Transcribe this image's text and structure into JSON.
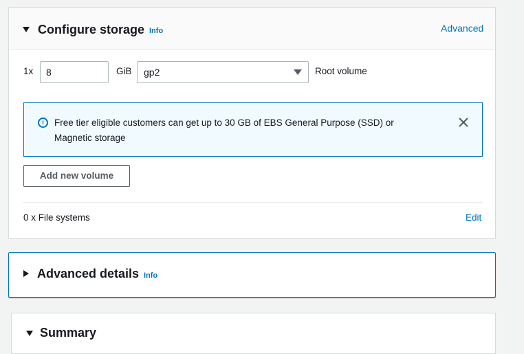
{
  "storage": {
    "title": "Configure storage",
    "info": "Info",
    "advanced_link": "Advanced",
    "volume": {
      "count": "1x",
      "size": "8",
      "unit": "GiB",
      "type": "gp2",
      "label": "Root volume"
    },
    "alert": {
      "text": "Free tier eligible customers can get up to 30 GB of EBS General Purpose (SSD) or Magnetic storage",
      "icon": "info-circle-icon",
      "close_icon": "close-icon"
    },
    "add_volume_button": "Add new volume",
    "file_systems": "0 x File systems",
    "edit_link": "Edit"
  },
  "advanced": {
    "title": "Advanced details",
    "info": "Info"
  },
  "summary": {
    "title": "Summary"
  },
  "colors": {
    "link": "#0073bb",
    "alert_background": "#f1faff",
    "page_background": "#f2f3f3"
  }
}
